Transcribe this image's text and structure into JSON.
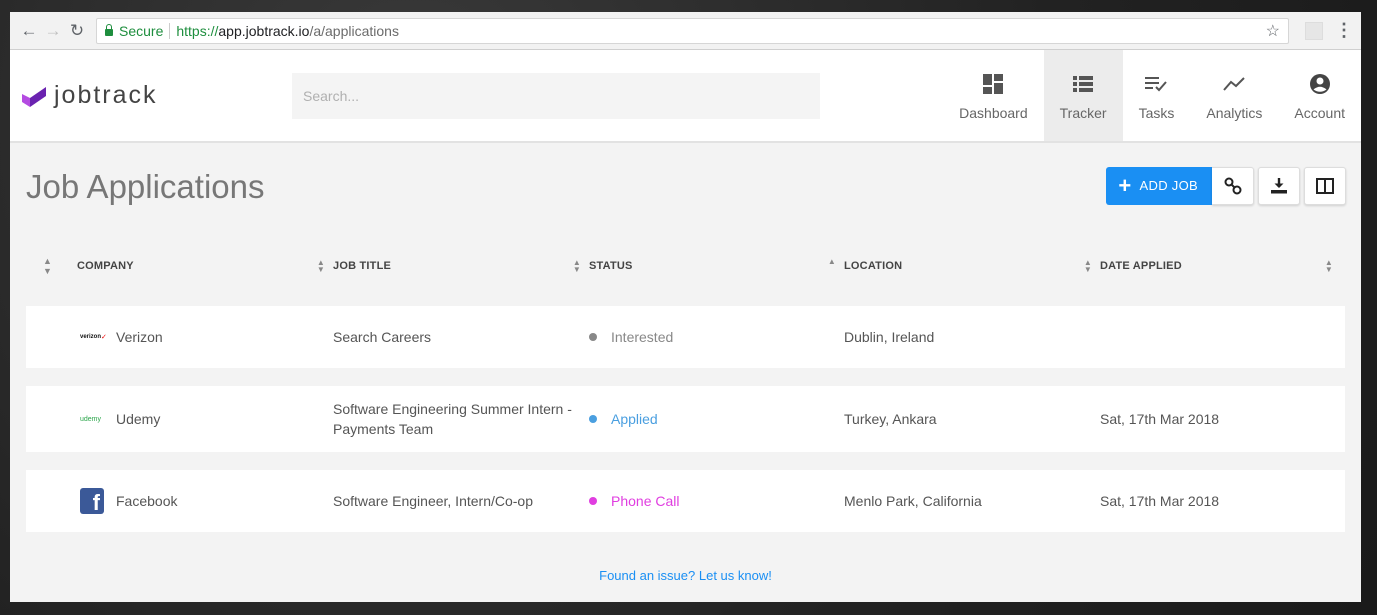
{
  "browser": {
    "secure_label": "Secure",
    "url_scheme": "https://",
    "url_host": "app.jobtrack.io",
    "url_path": "/a/applications"
  },
  "brand": {
    "name": "jobtrack",
    "accent": "#7b2fc2"
  },
  "search": {
    "placeholder": "Search..."
  },
  "nav": {
    "items": [
      {
        "label": "Dashboard",
        "icon": "dashboard-icon"
      },
      {
        "label": "Tracker",
        "icon": "list-icon",
        "active": true
      },
      {
        "label": "Tasks",
        "icon": "tasks-icon"
      },
      {
        "label": "Analytics",
        "icon": "analytics-icon"
      },
      {
        "label": "Account",
        "icon": "account-icon"
      }
    ]
  },
  "page": {
    "title": "Job Applications",
    "add_job_label": "ADD JOB",
    "footer_link": "Found an issue? Let us know!"
  },
  "table": {
    "columns": [
      "COMPANY",
      "JOB TITLE",
      "STATUS",
      "LOCATION",
      "DATE APPLIED"
    ],
    "rows": [
      {
        "company": "Verizon",
        "logo_text": "verizon",
        "job_title": "Search Careers",
        "status": "Interested",
        "status_color": "#888888",
        "location": "Dublin, Ireland",
        "date_applied": ""
      },
      {
        "company": "Udemy",
        "logo_text": "udemy",
        "job_title": "Software Engineering Summer Intern - Payments Team",
        "status": "Applied",
        "status_color": "#4a9fe0",
        "location": "Turkey, Ankara",
        "date_applied": "Sat, 17th Mar 2018"
      },
      {
        "company": "Facebook",
        "logo_text": "f",
        "job_title": "Software Engineer, Intern/Co-op",
        "status": "Phone Call",
        "status_color": "#e03ee0",
        "location": "Menlo Park, California",
        "date_applied": "Sat, 17th Mar 2018"
      }
    ]
  },
  "colors": {
    "primary": "#1a8ff3",
    "link": "#1a8ff3"
  }
}
